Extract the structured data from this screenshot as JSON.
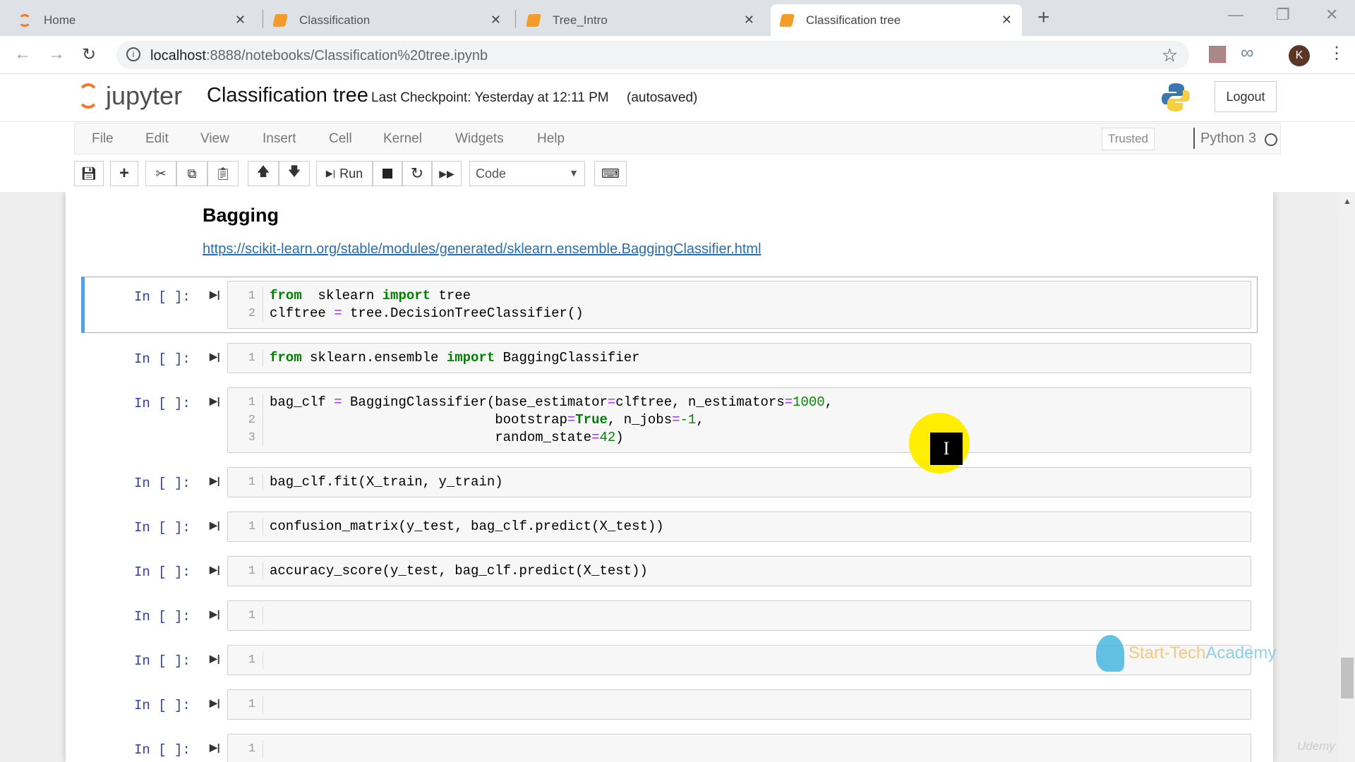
{
  "browser": {
    "tabs": [
      {
        "label": "Home",
        "icon": "jupyter-icon"
      },
      {
        "label": "Classification",
        "icon": "notebook-icon"
      },
      {
        "label": "Tree_Intro",
        "icon": "notebook-icon"
      },
      {
        "label": "Classification tree",
        "icon": "notebook-icon",
        "active": true
      }
    ],
    "url_host": "localhost",
    "url_path": ":8888/notebooks/Classification%20tree.ipynb",
    "profile_initial": "K"
  },
  "jupyter": {
    "logo_text": "jupyter",
    "notebook_title": "Classification tree",
    "checkpoint": "Last Checkpoint: Yesterday at 12:11 PM",
    "autosave": "(autosaved)",
    "logout": "Logout",
    "menu": [
      "File",
      "Edit",
      "View",
      "Insert",
      "Cell",
      "Kernel",
      "Widgets",
      "Help"
    ],
    "trusted": "Trusted",
    "kernel": "Python 3",
    "toolbar": {
      "run": "Run",
      "cell_type": "Code"
    }
  },
  "notebook": {
    "heading": "Bagging",
    "link": "https://scikit-learn.org/stable/modules/generated/sklearn.ensemble.BaggingClassifier.html",
    "cells": [
      {
        "prompt": "In [ ]:",
        "selected": true,
        "lines": [
          [
            [
              "kw",
              "from"
            ],
            [
              "",
              "  sklearn "
            ],
            [
              "kw",
              "import"
            ],
            [
              "",
              " tree"
            ]
          ],
          [
            [
              "",
              "clftree "
            ],
            [
              "op",
              "="
            ],
            [
              "",
              " tree.DecisionTreeClassifier()"
            ]
          ]
        ]
      },
      {
        "prompt": "In [ ]:",
        "lines": [
          [
            [
              "kw",
              "from"
            ],
            [
              "",
              " sklearn.ensemble "
            ],
            [
              "kw",
              "import"
            ],
            [
              "",
              " BaggingClassifier"
            ]
          ]
        ]
      },
      {
        "prompt": "In [ ]:",
        "lines": [
          [
            [
              "",
              "bag_clf "
            ],
            [
              "op",
              "="
            ],
            [
              "",
              " BaggingClassifier(base_estimator"
            ],
            [
              "op",
              "="
            ],
            [
              "",
              "clftree, n_estimators"
            ],
            [
              "op",
              "="
            ],
            [
              "num",
              "1000"
            ],
            [
              "",
              ","
            ]
          ],
          [
            [
              "",
              "                            bootstrap"
            ],
            [
              "op",
              "="
            ],
            [
              "kc",
              "True"
            ],
            [
              "",
              ", n_jobs"
            ],
            [
              "op",
              "="
            ],
            [
              "num",
              "-1"
            ],
            [
              "",
              ","
            ]
          ],
          [
            [
              "",
              "                            random_state"
            ],
            [
              "op",
              "="
            ],
            [
              "num",
              "42"
            ],
            [
              "",
              ")"
            ]
          ]
        ]
      },
      {
        "prompt": "In [ ]:",
        "lines": [
          [
            [
              "",
              "bag_clf.fit(X_train, y_train)"
            ]
          ]
        ]
      },
      {
        "prompt": "In [ ]:",
        "lines": [
          [
            [
              "",
              "confusion_matrix(y_test, bag_clf.predict(X_test))"
            ]
          ]
        ]
      },
      {
        "prompt": "In [ ]:",
        "lines": [
          [
            [
              "",
              "accuracy_score(y_test, bag_clf.predict(X_test))"
            ]
          ]
        ]
      },
      {
        "prompt": "In [ ]:",
        "lines": [
          [
            [
              "",
              ""
            ]
          ]
        ]
      },
      {
        "prompt": "In [ ]:",
        "lines": [
          [
            [
              "",
              ""
            ]
          ]
        ]
      },
      {
        "prompt": "In [ ]:",
        "lines": [
          [
            [
              "",
              ""
            ]
          ]
        ]
      },
      {
        "prompt": "In [ ]:",
        "lines": [
          [
            [
              "",
              ""
            ]
          ]
        ]
      }
    ]
  },
  "watermark": {
    "part1": "Start-Tech",
    "part2": "Academy",
    "udemy": "Udemy"
  }
}
